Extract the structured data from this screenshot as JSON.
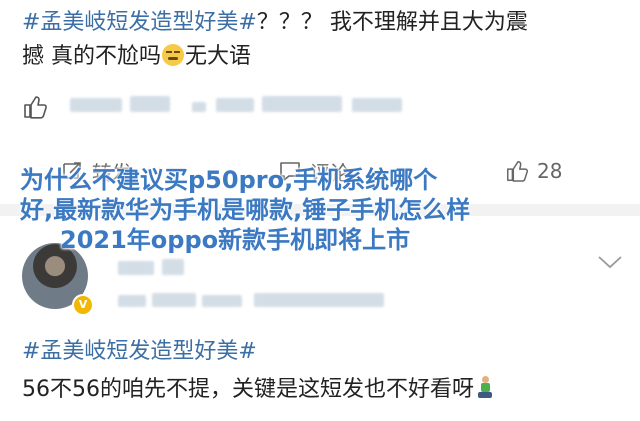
{
  "post1": {
    "hashtag": "#孟美岐短发造型好美#",
    "line1_rest": "？？？ 我不理解并且大为震",
    "line2_before": "撼 真的不尬吗",
    "line2_after": "无大语",
    "emoji": "grinning-face-emoji"
  },
  "like_row": {
    "icon": "thumbs-up-icon"
  },
  "actions": {
    "repost": {
      "icon": "repost-icon",
      "label": "转发"
    },
    "comment": {
      "icon": "comment-icon",
      "label": "评论"
    },
    "like": {
      "icon": "thumbs-up-icon",
      "count": "28"
    }
  },
  "overlay": {
    "line1": "为什么不建议买p50pro,手机系统哪个",
    "line2": "好,最新款华为手机是哪款,锤子手机怎么样",
    "line3": "2021年oppo新款手机即将上市"
  },
  "comment_user": {
    "badge": "V",
    "menu_icon": "chevron-down-icon"
  },
  "post2": {
    "hashtag": "#孟美岐短发造型好美#",
    "text": "56不56的咱先不提，关键是这短发也不好看呀",
    "emoji": "kneeling-person-emoji"
  },
  "colors": {
    "hashtag": "#3a6ea5",
    "overlay_text": "#3b79c2",
    "action_gray": "#666666",
    "divider": "#f2f2f2",
    "badge": "#f2b705"
  }
}
